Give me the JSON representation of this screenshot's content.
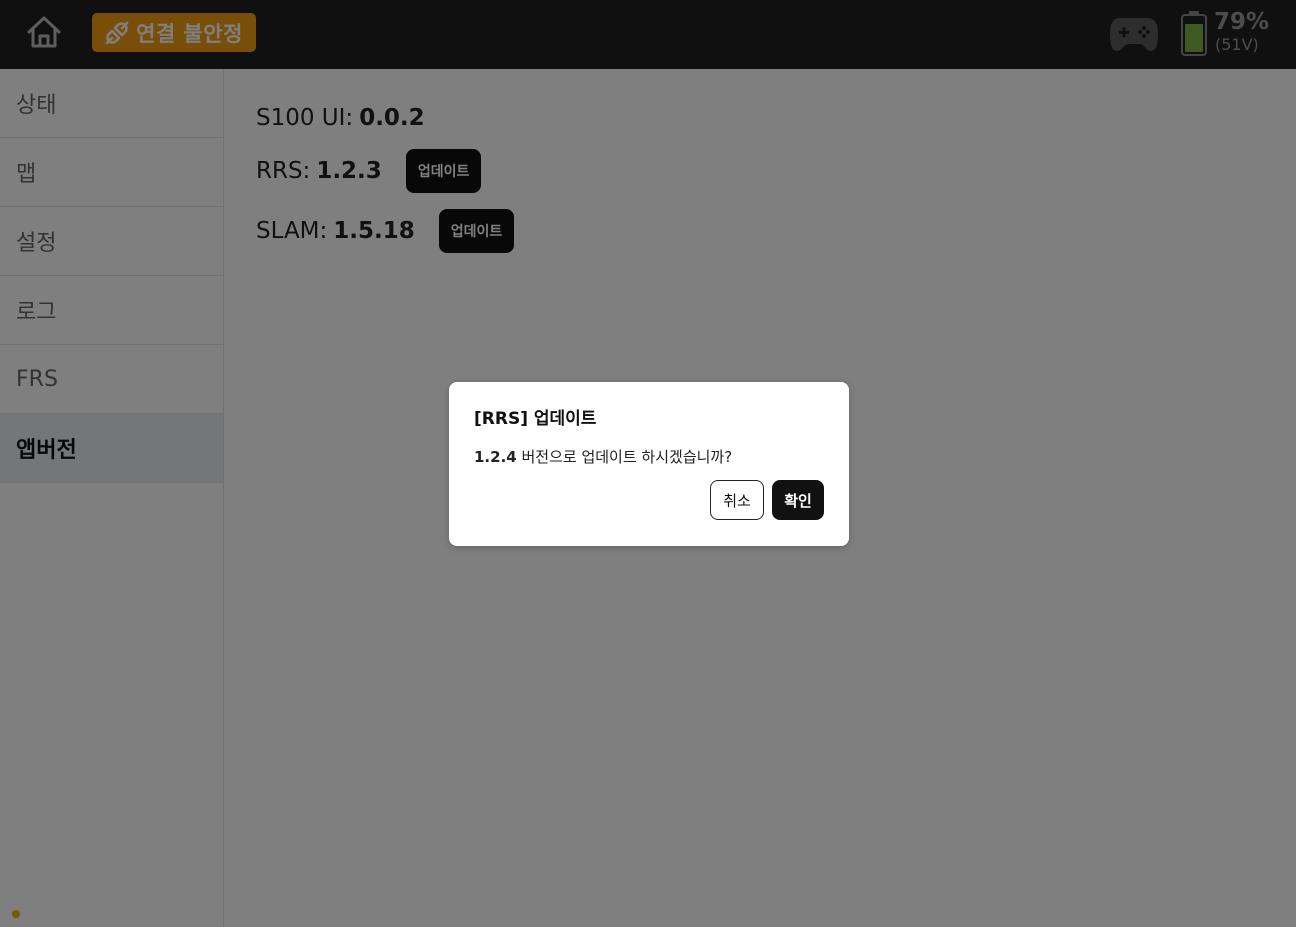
{
  "header": {
    "connection_status": "연결 불안정",
    "battery_percent": "79%",
    "battery_voltage": "(51V)",
    "battery_level": 0.79,
    "colors": {
      "bar_bg": "#212121",
      "badge_bg": "#f39c12",
      "battery_fill": "#7cb342"
    },
    "icons": [
      "home-icon",
      "plug-icon",
      "gamepad-icon",
      "battery-icon"
    ]
  },
  "sidebar": {
    "items": [
      {
        "label": "상태",
        "active": false
      },
      {
        "label": "맵",
        "active": false
      },
      {
        "label": "설정",
        "active": false
      },
      {
        "label": "로그",
        "active": false
      },
      {
        "label": "FRS",
        "active": false
      },
      {
        "label": "앱버전",
        "active": true
      }
    ]
  },
  "versions": {
    "s100ui": {
      "label": "S100 UI:",
      "value": "0.0.2"
    },
    "rrs": {
      "label": "RRS:",
      "value": "1.2.3",
      "button": "업데이트"
    },
    "slam": {
      "label": "SLAM:",
      "value": "1.5.18",
      "button": "업데이트"
    }
  },
  "dialog": {
    "title": "[RRS] 업데이트",
    "message_version": "1.2.4",
    "message_text": " 버전으로 업데이트 하시겠습니까?",
    "cancel_label": "취소",
    "confirm_label": "확인"
  }
}
